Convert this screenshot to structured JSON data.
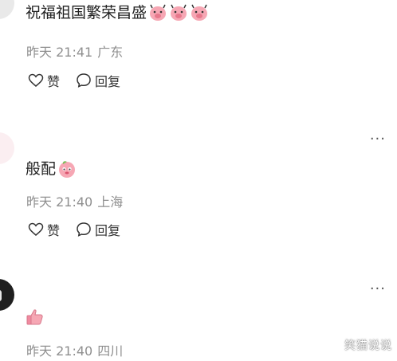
{
  "comments": [
    {
      "text": "祝福祖国繁荣昌盛",
      "emojis": [
        "pig-face-emoji",
        "pig-face-emoji",
        "pig-face-emoji"
      ],
      "time": "昨天 21:41",
      "location": "广东",
      "like_label": "赞",
      "reply_label": "回复"
    },
    {
      "text": "般配",
      "emojis": [
        "peach-face-emoji"
      ],
      "time": "昨天 21:40",
      "location": "上海",
      "like_label": "赞",
      "reply_label": "回复",
      "more": "···"
    },
    {
      "text": "",
      "emojis": [
        "thumbs-up-emoji"
      ],
      "time": "昨天 21:40",
      "location": "四川",
      "more": "···"
    }
  ],
  "watermark": "笑猫说说",
  "colors": {
    "meta": "#8f8f8f",
    "text": "#222222",
    "emoji_pink": "#f6a7b4"
  }
}
